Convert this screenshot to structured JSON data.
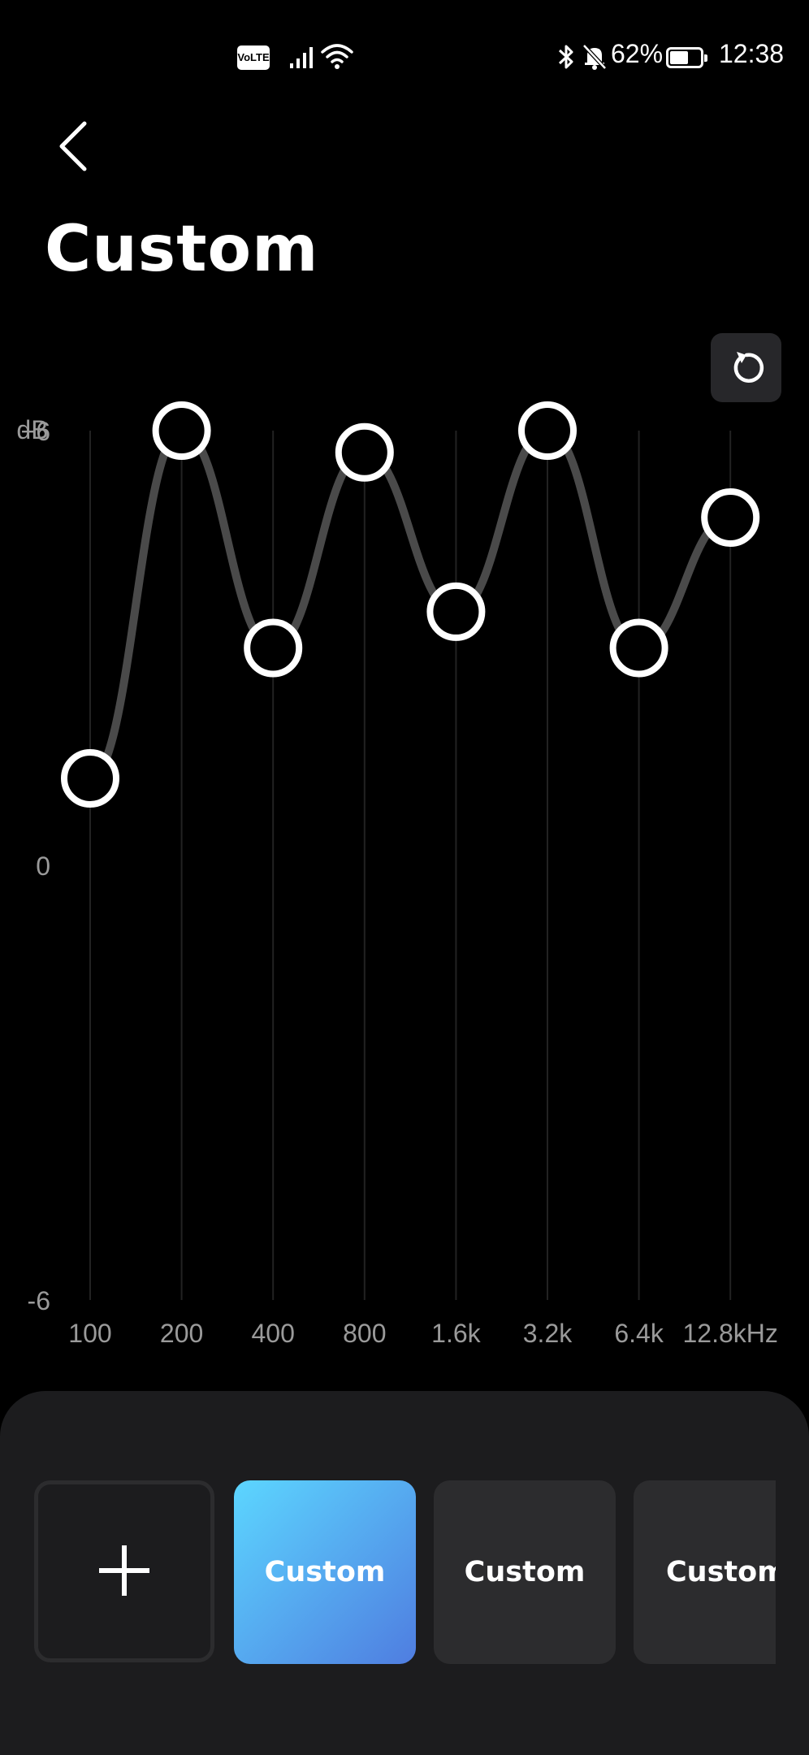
{
  "status_bar": {
    "volte": "VoLTE",
    "battery_percent_label": "62%",
    "battery_level": 0.62,
    "time": "12:38",
    "icons": [
      "volte-icon",
      "signal-icon",
      "wifi-icon",
      "bluetooth-icon",
      "mute-bell-icon",
      "battery-saver-icon"
    ]
  },
  "header": {
    "back_icon": "chevron-left-icon",
    "title": "Custom",
    "reset_icon": "reset-icon"
  },
  "chart_data": {
    "type": "line",
    "ylabel": "dB",
    "yticks": [
      "+6",
      "0",
      "-6"
    ],
    "ylim": [
      -6,
      6
    ],
    "categories": [
      "100",
      "200",
      "400",
      "800",
      "1.6k",
      "3.2k",
      "6.4k",
      "12.8kHz"
    ],
    "values": [
      1.2,
      6.0,
      3.0,
      5.7,
      3.5,
      6.0,
      3.0,
      4.8
    ],
    "grid": "vertical",
    "colors": {
      "curve": "#4a4a4a",
      "grid": "#222222",
      "handle": "#ffffff"
    }
  },
  "presets": {
    "add_icon": "plus-icon",
    "items": [
      {
        "label": "Custom",
        "active": true
      },
      {
        "label": "Custom",
        "active": false
      },
      {
        "label": "Custom",
        "active": false
      }
    ]
  },
  "colors": {
    "background": "#000000",
    "sheet": "#1c1c1e",
    "card": "#2c2c2e",
    "accent_start": "#5cd6ff",
    "accent_end": "#4f7de0"
  }
}
